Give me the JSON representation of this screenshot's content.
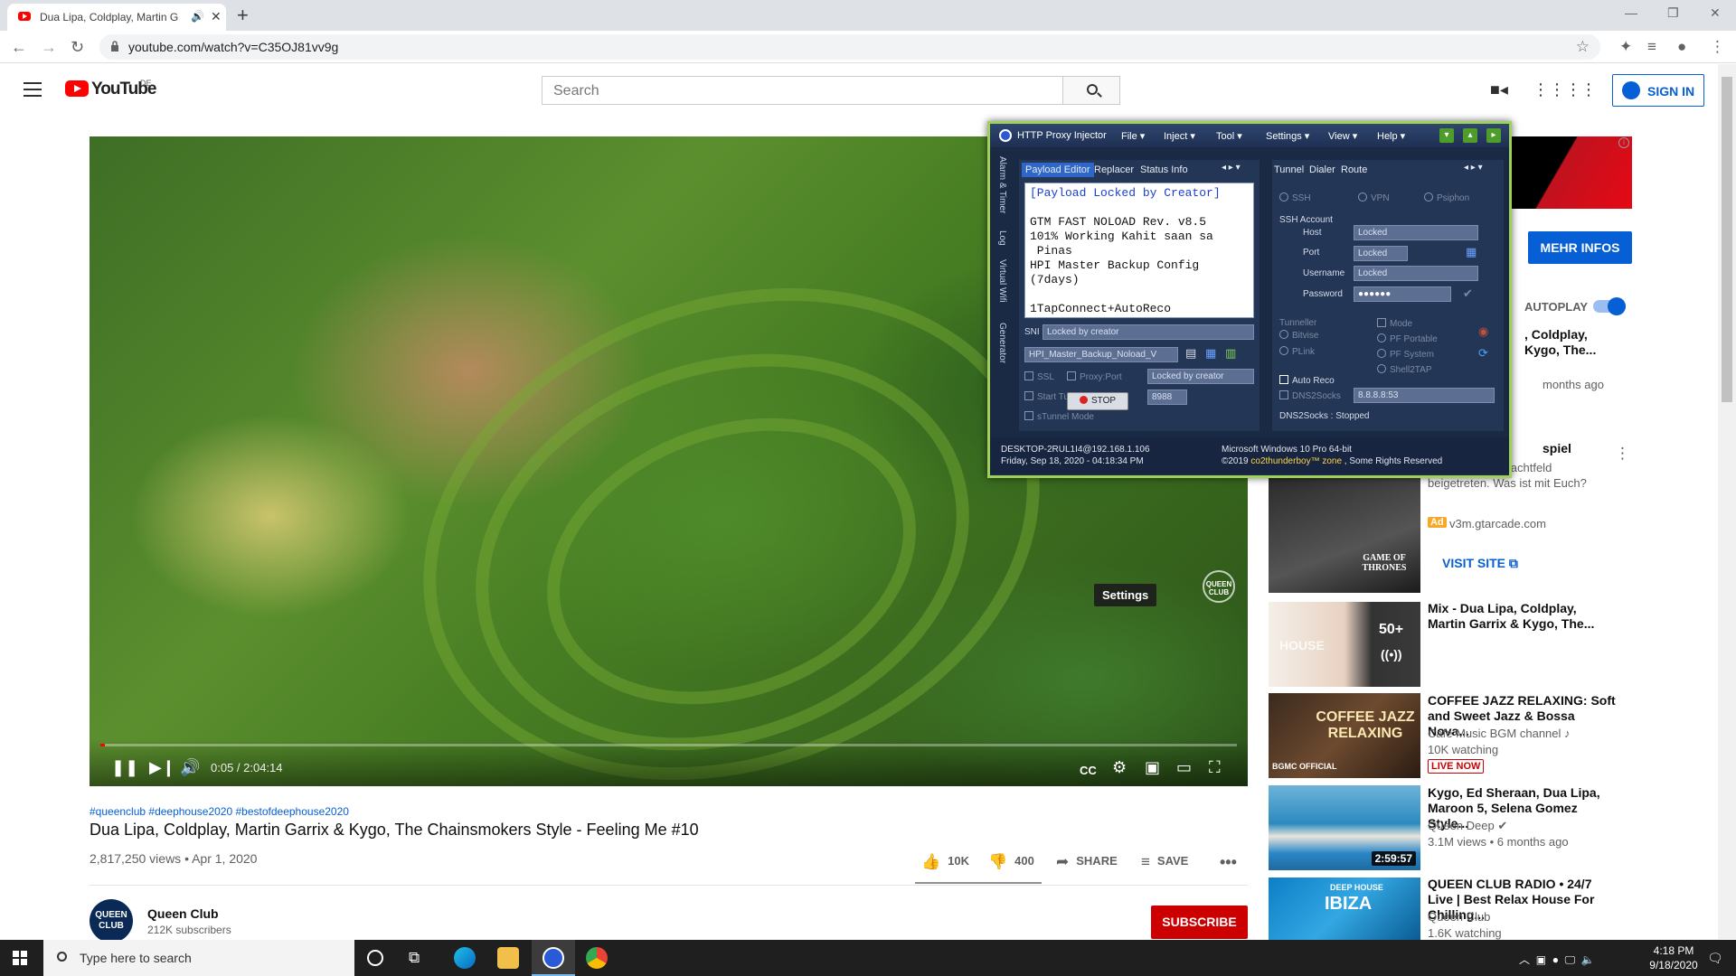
{
  "browser": {
    "tab_title": "Dua Lipa, Coldplay, Martin G",
    "url": "youtube.com/watch?v=C35OJ81vv9g",
    "new_tab": "+"
  },
  "youtube": {
    "logo": "YouTube",
    "country": "DE",
    "search_placeholder": "Search",
    "sign_in": "SIGN IN"
  },
  "video": {
    "time": "0:05 / 2:04:14",
    "progress_fraction": 0.0007,
    "settings_tooltip": "Settings",
    "watermark": "QUEEN CLUB",
    "hashtags": "#queenclub #deephouse2020 #bestofdeephouse2020",
    "title": "Dua Lipa, Coldplay, Martin Garrix & Kygo, The Chainsmokers Style - Feeling Me #10",
    "views_date": "2,817,250 views • Apr 1, 2020",
    "likes": "10K",
    "dislikes": "400",
    "share": "SHARE",
    "save": "SAVE"
  },
  "channel": {
    "avatar_text": "QUEEN CLUB",
    "name": "Queen Club",
    "subscribers": "212K subscribers",
    "subscribe": "SUBSCRIBE"
  },
  "sidebar": {
    "mehr_infos": "MEHR INFOS",
    "autoplay": "AUTOPLAY",
    "next_title": ", Coldplay,\n Kygo, The...",
    "next_meta": "months ago",
    "ad": {
      "title": "spiel",
      "desc": "s sind dem Schlachtfeld beigetreten. Was ist mit Euch?",
      "tag": "Ad",
      "domain": "v3m.gtarcade.com",
      "visit": "VISIT SITE",
      "thumb_text": "GAME OF THRONES"
    },
    "items": [
      {
        "title": "Mix - Dua Lipa, Coldplay, Martin Garrix & Kygo, The...",
        "line1": "",
        "line2": "",
        "thumb_text": "50+",
        "thumb_sub": "HOUSE"
      },
      {
        "title": "COFFEE JAZZ RELAXING: Soft and Sweet Jazz & Bossa Nova...",
        "line1": "Cafe Music BGM channel ♪",
        "line2": "10K watching",
        "live": "LIVE NOW",
        "thumb_text": "COFFEE JAZZ RELAXING",
        "thumb_sub": "BGMC OFFICIAL"
      },
      {
        "title": "Kygo, Ed Sheraan, Dua Lipa, Maroon 5, Selena Gomez Style...",
        "line1": "Queen Deep ✔",
        "line2": "3.1M views • 6 months ago",
        "duration": "2:59:57"
      },
      {
        "title": "QUEEN CLUB RADIO • 24/7 Live | Best Relax House For Chilling...",
        "line1": "Queen Club",
        "line2": "1.6K watching",
        "thumb_text": "IBIZA",
        "thumb_sub": "DEEP HOUSE"
      }
    ]
  },
  "proxy": {
    "title": "HTTP Proxy Injector",
    "menus": [
      "File",
      "Inject",
      "Tool",
      "Settings",
      "View",
      "Help"
    ],
    "left_tabs": [
      "Payload Editor",
      "Replacer",
      "Status Info"
    ],
    "right_tabs": [
      "Tunnel",
      "Dialer",
      "Route"
    ],
    "vertical_tabs": [
      "Alarm & Timer",
      "Log",
      "Virtual Wifi",
      "Generator"
    ],
    "payload_lines": [
      "[Payload Locked by Creator]",
      "",
      "GTM FAST NOLOAD Rev. v8.5",
      "101% Working Kahit saan sa",
      " Pinas",
      "HPI Master Backup Config",
      "(7days)",
      "",
      "1TapConnect+AutoReco"
    ],
    "sni_label": "SNI",
    "sni_value": "Locked by creator",
    "config_file": "HPI_Master_Backup_Noload_V",
    "ssl": "SSL",
    "proxy_port": "Proxy:Port",
    "proxy_value": "Locked by creator",
    "start_tunnel": "Start Tunnel",
    "port_value": "8988",
    "stop": "STOP",
    "stunnel": "sTunnel Mode",
    "ssh": "SSH",
    "vpn": "VPN",
    "psiphon": "Psiphon",
    "ssh_account": "SSH Account",
    "host_label": "Host",
    "host_value": "Locked",
    "port_label": "Port",
    "port_field": "Locked",
    "user_label": "Username",
    "user_value": "Locked",
    "pass_label": "Password",
    "pass_value": "●●●●●●",
    "tunneller": "Tunneller",
    "bitvise": "Bitvise",
    "plink": "PLink",
    "mode": "Mode",
    "pf_portable": "PF Portable",
    "pf_system": "PF System",
    "shell2tap": "Shell2TAP",
    "auto_reco": "Auto Reco",
    "dns2socks_label": "DNS2Socks",
    "dns_value": "8.8.8.8:53",
    "dns_status": "DNS2Socks : Stopped",
    "status_host": "DESKTOP-2RUL1I4@192.168.1.106",
    "status_date": "Friday, Sep 18, 2020 - 04:18:34 PM",
    "status_os": "Microsoft Windows 10 Pro 64-bit",
    "status_copy_a": "©2019 ",
    "status_copy_b": "co2thunderboy™ zone",
    "status_copy_c": " , Some Rights Reserved"
  },
  "taskbar": {
    "search_placeholder": "Type here to search",
    "time": "4:18 PM",
    "date": "9/18/2020"
  }
}
